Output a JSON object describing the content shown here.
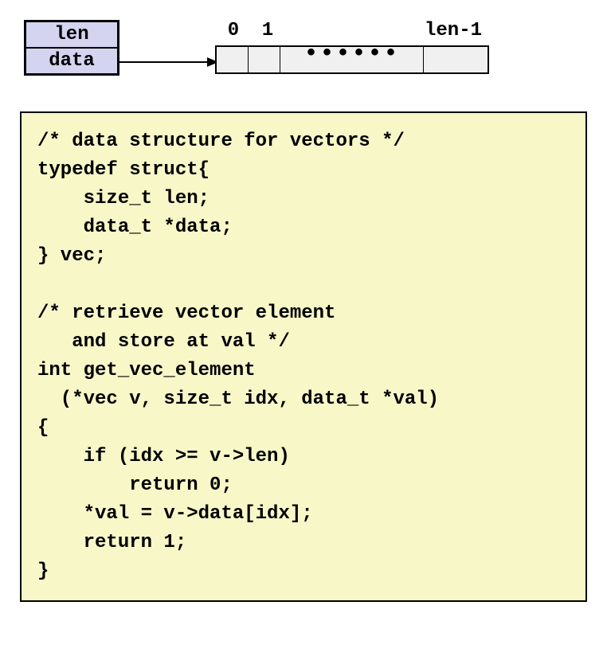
{
  "diagram": {
    "struct_fields": {
      "field1": "len",
      "field2": "data"
    },
    "array_labels": {
      "idx0": "0",
      "idx1": "1",
      "last": "len-1"
    },
    "ellipsis": "••••••"
  },
  "code": {
    "line1": "/* data structure for vectors */",
    "line2": "typedef struct{",
    "line3": "    size_t len;",
    "line4": "    data_t *data;",
    "line5": "} vec;",
    "line6": "",
    "line7": "/* retrieve vector element",
    "line8": "   and store at val */",
    "line9": "int get_vec_element",
    "line10": "  (*vec v, size_t idx, data_t *val)",
    "line11": "{",
    "line12": "    if (idx >= v->len)",
    "line13": "        return 0;",
    "line14": "    *val = v->data[idx];",
    "line15": "    return 1;",
    "line16": "}"
  }
}
